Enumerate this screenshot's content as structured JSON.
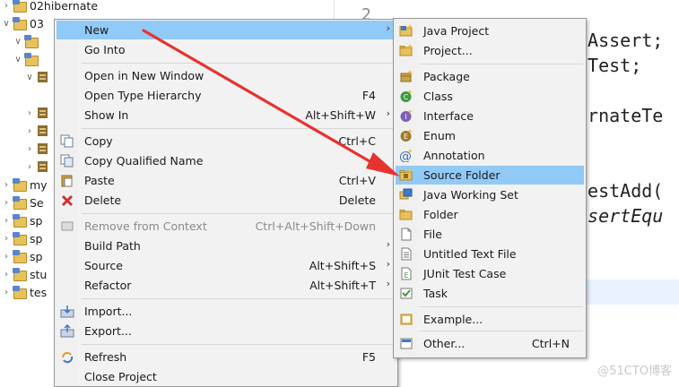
{
  "explorer": {
    "items": [
      {
        "label": "02hibernate",
        "expanded": false,
        "indent": 0
      },
      {
        "label": "03",
        "expanded": true,
        "indent": 0
      },
      {
        "label": "",
        "expanded": true,
        "indent": 1
      },
      {
        "label": "",
        "expanded": true,
        "indent": 1
      },
      {
        "label": "",
        "expanded": true,
        "indent": 2
      },
      {
        "label": "",
        "expanded": false,
        "indent": 2
      },
      {
        "label": "",
        "expanded": false,
        "indent": 2
      },
      {
        "label": "",
        "expanded": false,
        "indent": 2
      },
      {
        "label": "",
        "expanded": false,
        "indent": 2
      },
      {
        "label": "my",
        "expanded": false,
        "indent": 0
      },
      {
        "label": "Se",
        "expanded": false,
        "indent": 0
      },
      {
        "label": "sp",
        "expanded": false,
        "indent": 0
      },
      {
        "label": "sp",
        "expanded": false,
        "indent": 0
      },
      {
        "label": "sp",
        "expanded": false,
        "indent": 0
      },
      {
        "label": "stu",
        "expanded": false,
        "indent": 0
      },
      {
        "label": "tes",
        "expanded": false,
        "indent": 0
      }
    ]
  },
  "editor": {
    "line_number": "2",
    "code_lines": [
      {
        "text": ".Assert;",
        "italic": false
      },
      {
        "text": ".Test;",
        "italic": false
      },
      {
        "text": "ernateTe",
        "italic": false
      },
      {
        "text": "testAdd(",
        "italic": false
      },
      {
        "text": "ssertEqu",
        "italic": true
      }
    ]
  },
  "context_menu": {
    "items": [
      {
        "label": "New",
        "shortcut": "",
        "submenu": true,
        "icon": "",
        "highlighted": true
      },
      {
        "label": "Go Into",
        "shortcut": "",
        "submenu": false,
        "icon": ""
      },
      {
        "label": "Open in New Window",
        "shortcut": "",
        "submenu": false,
        "icon": ""
      },
      {
        "label": "Open Type Hierarchy",
        "shortcut": "F4",
        "submenu": false,
        "icon": ""
      },
      {
        "label": "Show In",
        "shortcut": "Alt+Shift+W",
        "submenu": true,
        "icon": ""
      },
      {
        "label": "Copy",
        "shortcut": "Ctrl+C",
        "submenu": false,
        "icon": "copy-icon"
      },
      {
        "label": "Copy Qualified Name",
        "shortcut": "",
        "submenu": false,
        "icon": "copy-qualified-icon"
      },
      {
        "label": "Paste",
        "shortcut": "Ctrl+V",
        "submenu": false,
        "icon": "paste-icon"
      },
      {
        "label": "Delete",
        "shortcut": "Delete",
        "submenu": false,
        "icon": "delete-icon"
      },
      {
        "label": "Remove from Context",
        "shortcut": "Ctrl+Alt+Shift+Down",
        "submenu": false,
        "icon": "remove-context-icon",
        "disabled": true
      },
      {
        "label": "Build Path",
        "shortcut": "",
        "submenu": true,
        "icon": ""
      },
      {
        "label": "Source",
        "shortcut": "Alt+Shift+S",
        "submenu": true,
        "icon": ""
      },
      {
        "label": "Refactor",
        "shortcut": "Alt+Shift+T",
        "submenu": true,
        "icon": ""
      },
      {
        "label": "Import...",
        "shortcut": "",
        "submenu": false,
        "icon": "import-icon"
      },
      {
        "label": "Export...",
        "shortcut": "",
        "submenu": false,
        "icon": "export-icon"
      },
      {
        "label": "Refresh",
        "shortcut": "F5",
        "submenu": false,
        "icon": "refresh-icon"
      },
      {
        "label": "Close Project",
        "shortcut": "",
        "submenu": false,
        "icon": ""
      }
    ]
  },
  "new_submenu": {
    "items": [
      {
        "label": "Java Project",
        "shortcut": "",
        "icon": "java-project-icon"
      },
      {
        "label": "Project...",
        "shortcut": "",
        "icon": "project-icon"
      },
      {
        "label": "Package",
        "shortcut": "",
        "icon": "package-icon"
      },
      {
        "label": "Class",
        "shortcut": "",
        "icon": "class-icon"
      },
      {
        "label": "Interface",
        "shortcut": "",
        "icon": "interface-icon"
      },
      {
        "label": "Enum",
        "shortcut": "",
        "icon": "enum-icon"
      },
      {
        "label": "Annotation",
        "shortcut": "",
        "icon": "annotation-icon"
      },
      {
        "label": "Source Folder",
        "shortcut": "",
        "icon": "source-folder-icon",
        "highlighted": true
      },
      {
        "label": "Java Working Set",
        "shortcut": "",
        "icon": "working-set-icon"
      },
      {
        "label": "Folder",
        "shortcut": "",
        "icon": "folder-icon"
      },
      {
        "label": "File",
        "shortcut": "",
        "icon": "file-icon"
      },
      {
        "label": "Untitled Text File",
        "shortcut": "",
        "icon": "text-file-icon"
      },
      {
        "label": "JUnit Test Case",
        "shortcut": "",
        "icon": "junit-icon"
      },
      {
        "label": "Task",
        "shortcut": "",
        "icon": "task-icon"
      },
      {
        "label": "Example...",
        "shortcut": "",
        "icon": "example-icon"
      },
      {
        "label": "Other...",
        "shortcut": "Ctrl+N",
        "icon": "other-icon"
      }
    ]
  },
  "watermark": "@51CTO博客",
  "colors": {
    "highlight": "#91c9f7",
    "arrow": "#e8322f",
    "menu_bg": "#f2f2f2"
  }
}
